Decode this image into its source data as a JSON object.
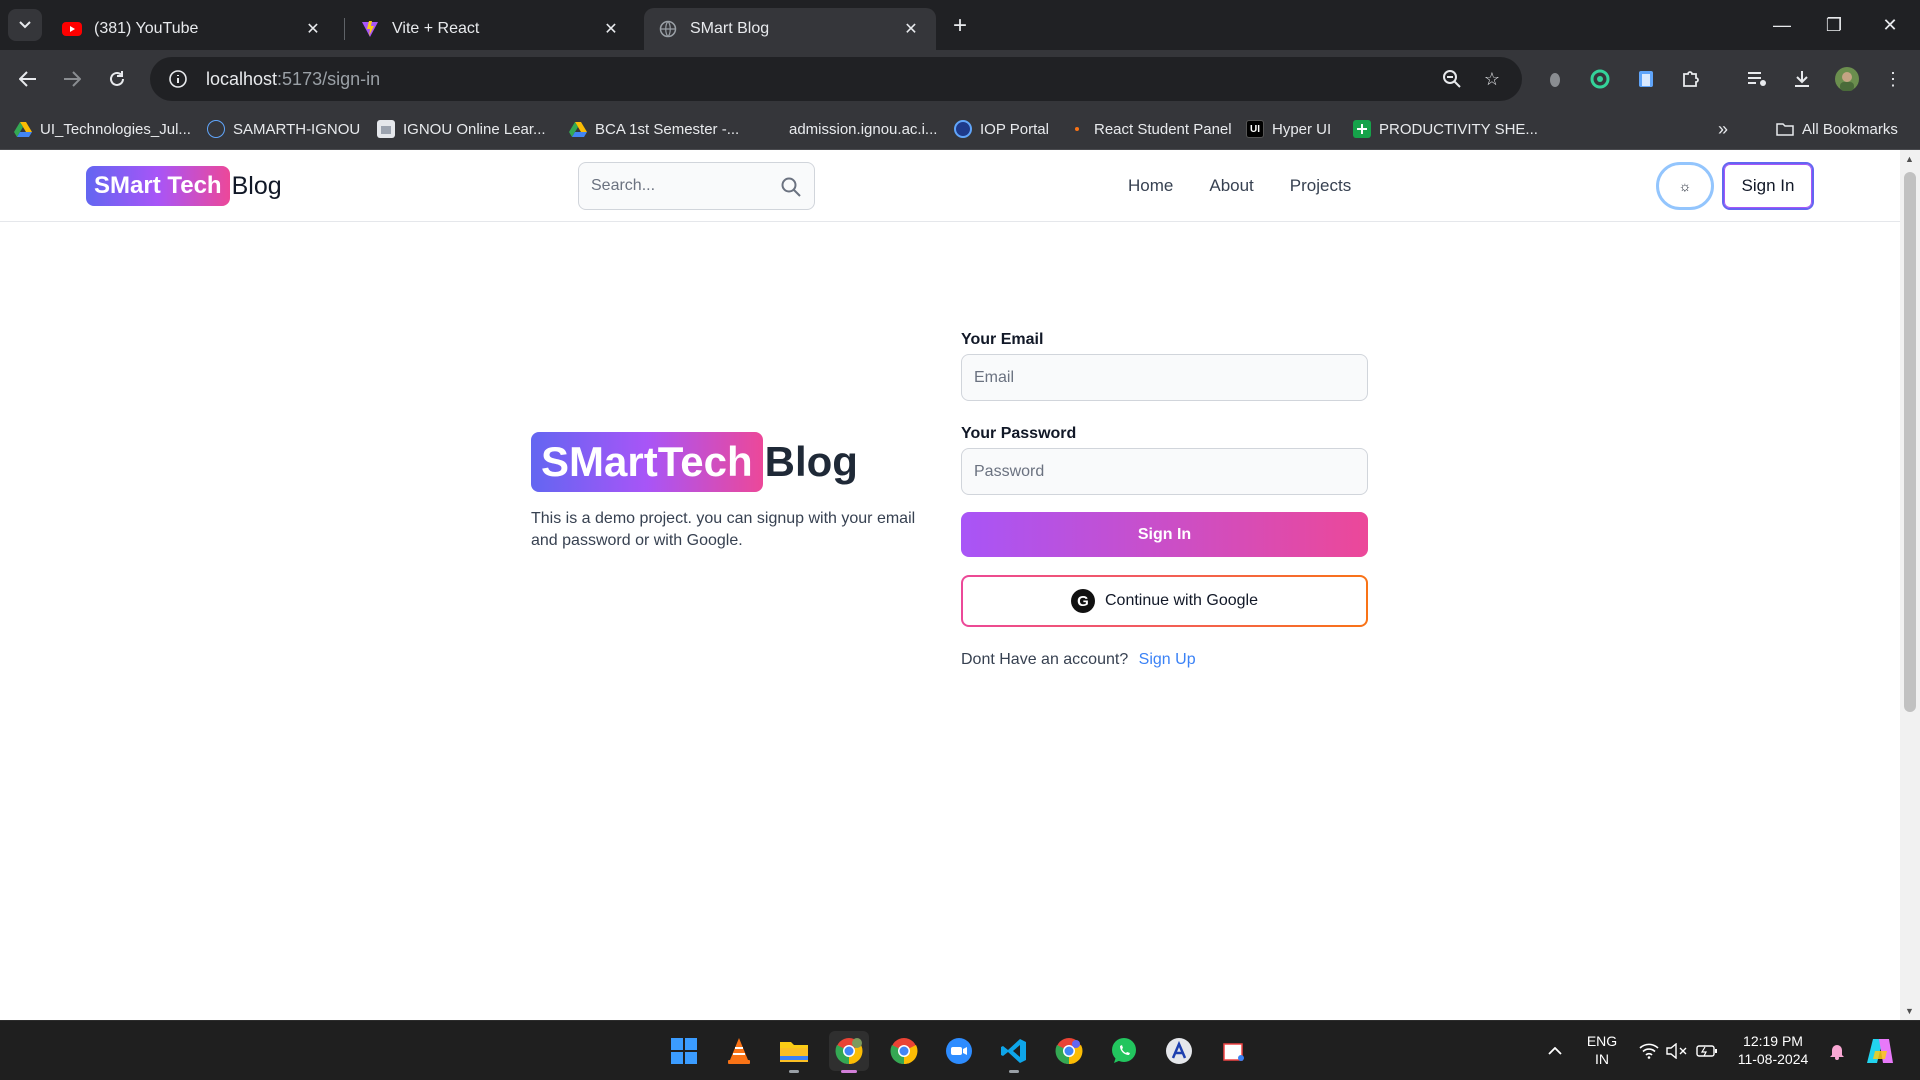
{
  "browser": {
    "tabs": [
      {
        "title": "(381) YouTube",
        "icon": "youtube-icon"
      },
      {
        "title": "Vite + React",
        "icon": "vite-icon"
      },
      {
        "title": "SMart Blog",
        "icon": "globe-icon",
        "active": true
      }
    ],
    "url_host": "localhost",
    "url_path": ":5173/sign-in",
    "bookmarks": [
      {
        "label": "UI_Technologies_Jul...",
        "icon": "google-drive-icon"
      },
      {
        "label": "SAMARTH-IGNOU",
        "icon": "samarth-icon"
      },
      {
        "label": "IGNOU Online Lear...",
        "icon": "ignou-icon"
      },
      {
        "label": "BCA 1st Semester -...",
        "icon": "google-drive-icon"
      },
      {
        "label": "admission.ignou.ac.i...",
        "icon": "blank-icon"
      },
      {
        "label": "IOP Portal",
        "icon": "iop-icon"
      },
      {
        "label": "React Student Panel",
        "icon": "dot-icon"
      },
      {
        "label": "Hyper UI",
        "icon": "hyperui-icon"
      },
      {
        "label": "PRODUCTIVITY SHE...",
        "icon": "sheets-icon"
      }
    ],
    "all_bookmarks": "All Bookmarks"
  },
  "site": {
    "logo_grad": "SMart Tech",
    "logo_plain": "Blog",
    "search_placeholder": "Search...",
    "nav": [
      "Home",
      "About",
      "Projects"
    ],
    "theme_glyph": "☼",
    "sign_in_top": "Sign In"
  },
  "hero": {
    "logo_grad": "SMartTech",
    "logo_plain": "Blog",
    "description": "This is a demo project. you can signup with your email and password or with Google."
  },
  "form": {
    "email_label": "Your Email",
    "email_placeholder": "Email",
    "password_label": "Your Password",
    "password_placeholder": "Password",
    "sign_in": "Sign In",
    "google": "Continue with Google",
    "no_account": "Dont Have an account?",
    "sign_up": "Sign Up"
  },
  "taskbar": {
    "lang_top": "ENG",
    "lang_bottom": "IN",
    "time": "12:19 PM",
    "date": "11-08-2024"
  },
  "colors": {
    "gradient_start": "#6366f1",
    "gradient_mid": "#a855f7",
    "gradient_end": "#ec4899",
    "link": "#3b82f6",
    "chrome_dark": "#202124",
    "chrome_toolbar": "#35363a"
  }
}
